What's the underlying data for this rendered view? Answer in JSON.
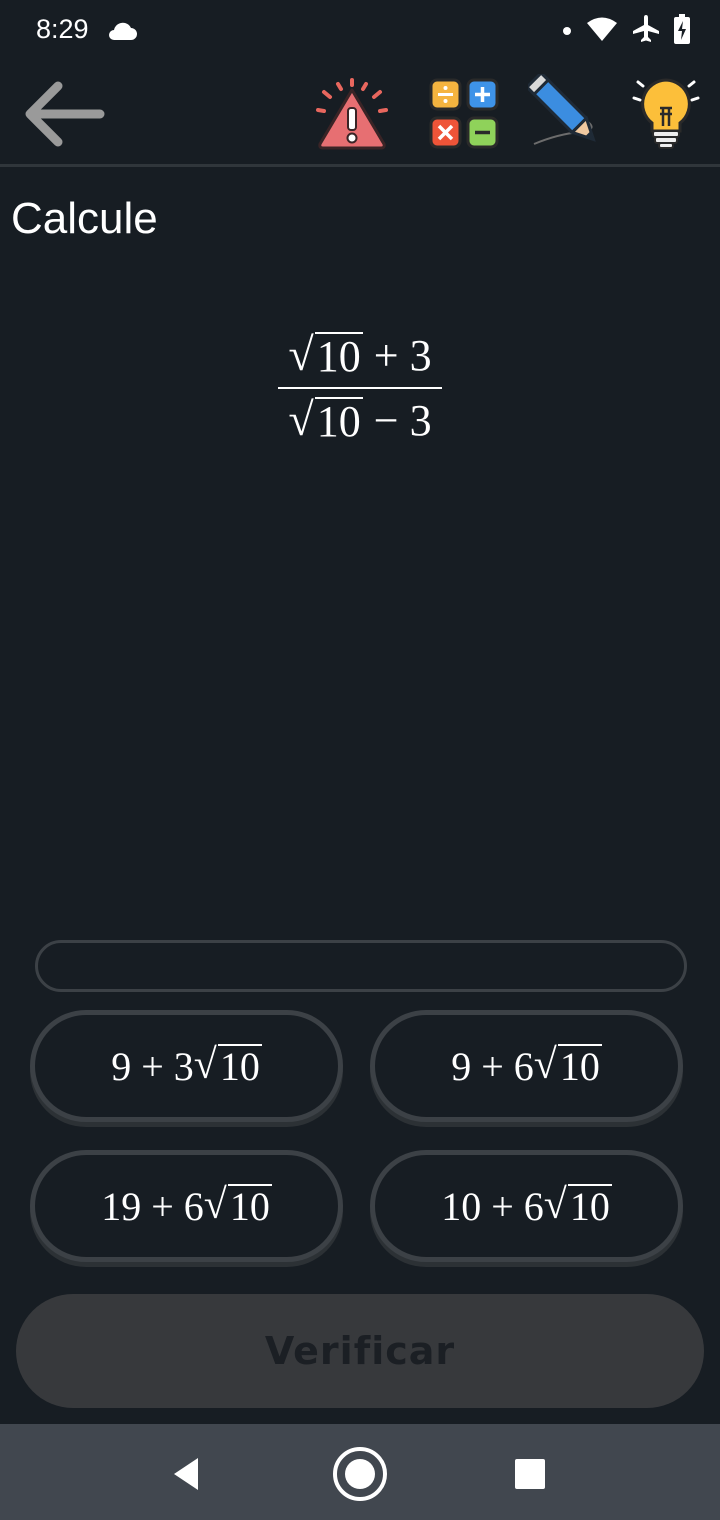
{
  "status": {
    "time": "8:29",
    "icons": [
      "cloud-icon",
      "notification-dot-icon",
      "wifi-icon",
      "airplane-icon",
      "battery-icon"
    ]
  },
  "toolbar": {
    "icons": [
      "back-arrow-icon",
      "report-alert-icon",
      "calculator-icon",
      "pencil-icon",
      "hint-lightbulb-icon"
    ]
  },
  "question": {
    "title": "Calcule",
    "expression": {
      "numerator": {
        "radicand": "10",
        "rest": " + 3"
      },
      "denominator": {
        "radicand": "10",
        "rest": " − 3"
      }
    }
  },
  "answer": {
    "value": ""
  },
  "options": [
    {
      "prefix": "9 + 3",
      "radicand": "10"
    },
    {
      "prefix": "9 + 6",
      "radicand": "10"
    },
    {
      "prefix": "19 + 6",
      "radicand": "10"
    },
    {
      "prefix": "10 + 6",
      "radicand": "10"
    }
  ],
  "verify": {
    "label": "Verificar",
    "enabled": false
  },
  "navbar": {
    "icons": [
      "nav-back-icon",
      "nav-home-icon",
      "nav-recents-icon"
    ]
  },
  "colors": {
    "background": "#171d23",
    "navbar": "#41474f",
    "button_disabled": "#37393c"
  }
}
